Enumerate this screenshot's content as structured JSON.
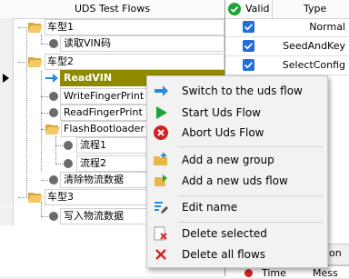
{
  "flows_panel": {
    "header": "UDS Test Flows",
    "items": [
      {
        "label": "车型1"
      },
      {
        "label": "读取VIN码"
      },
      {
        "label": "车型2"
      },
      {
        "label": "ReadVIN"
      },
      {
        "label": "WriteFingerPrint"
      },
      {
        "label": "ReadFingerPrint"
      },
      {
        "label": "FlashBootloader"
      },
      {
        "label": "流程1"
      },
      {
        "label": "流程2"
      },
      {
        "label": "清除物流数据"
      },
      {
        "label": "车型3"
      },
      {
        "label": "写入物流数据"
      }
    ]
  },
  "config_table": {
    "headers": {
      "valid": "Valid",
      "type": "Type"
    },
    "rows": [
      {
        "valid": true,
        "type": "Normal"
      },
      {
        "valid": true,
        "type": "SeedAndKey"
      },
      {
        "valid": true,
        "type": "SelectConfig"
      }
    ]
  },
  "bottom_fragments": {
    "tab": "on",
    "col1": "Time",
    "col2": "Mess"
  },
  "context_menu": {
    "items": [
      {
        "label": "Switch to the uds flow",
        "icon": "arrow-right-icon"
      },
      {
        "label": "Start Uds Flow",
        "icon": "play-icon"
      },
      {
        "label": "Abort Uds Flow",
        "icon": "abort-icon"
      },
      {
        "label": "Add a new group",
        "icon": "folder-add-icon"
      },
      {
        "label": "Add a new uds flow",
        "icon": "flow-add-icon"
      },
      {
        "label": "Edit name",
        "icon": "edit-icon"
      },
      {
        "label": "Delete selected",
        "icon": "delete-selected-icon"
      },
      {
        "label": "Delete all flows",
        "icon": "delete-all-icon"
      }
    ]
  },
  "colors": {
    "selection": "#8f8a00",
    "play": "#1ea337",
    "abort": "#d42222",
    "check": "#1e6fd9",
    "folder": "#e8b84a"
  }
}
